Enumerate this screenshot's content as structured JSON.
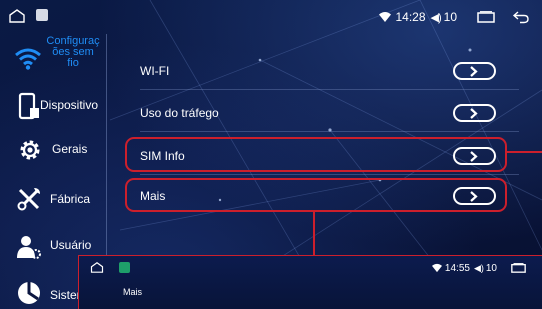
{
  "status_bar": {
    "time": "14:28",
    "volume_level": "10",
    "icons": [
      "home-icon",
      "app-icon",
      "wifi-icon",
      "volume-icon",
      "recent-apps-icon",
      "back-icon"
    ]
  },
  "sidebar": {
    "items": [
      {
        "label": "Configurações sem fio",
        "label_lines": [
          "Configuraç",
          "ões sem",
          "fio"
        ],
        "icon": "wifi-icon",
        "selected": true
      },
      {
        "label": "Dispositivo",
        "icon": "device-icon"
      },
      {
        "label": "Gerais",
        "icon": "gear-icon"
      },
      {
        "label": "Fábrica",
        "icon": "tools-icon"
      },
      {
        "label": "Usuário",
        "icon": "user-icon"
      },
      {
        "label": "Sister",
        "icon": "system-icon"
      }
    ]
  },
  "rows": [
    {
      "label": "WI-FI",
      "highlighted": false
    },
    {
      "label": "Uso do tráfego",
      "highlighted": false
    },
    {
      "label": "SIM Info",
      "highlighted": true
    },
    {
      "label": "Mais",
      "highlighted": true
    }
  ],
  "inset": {
    "time": "14:55",
    "volume_level": "10",
    "title": "Mais"
  },
  "colors": {
    "accent": "#1f8df5",
    "highlight": "#cc1f2c",
    "background": "#0b1640"
  }
}
